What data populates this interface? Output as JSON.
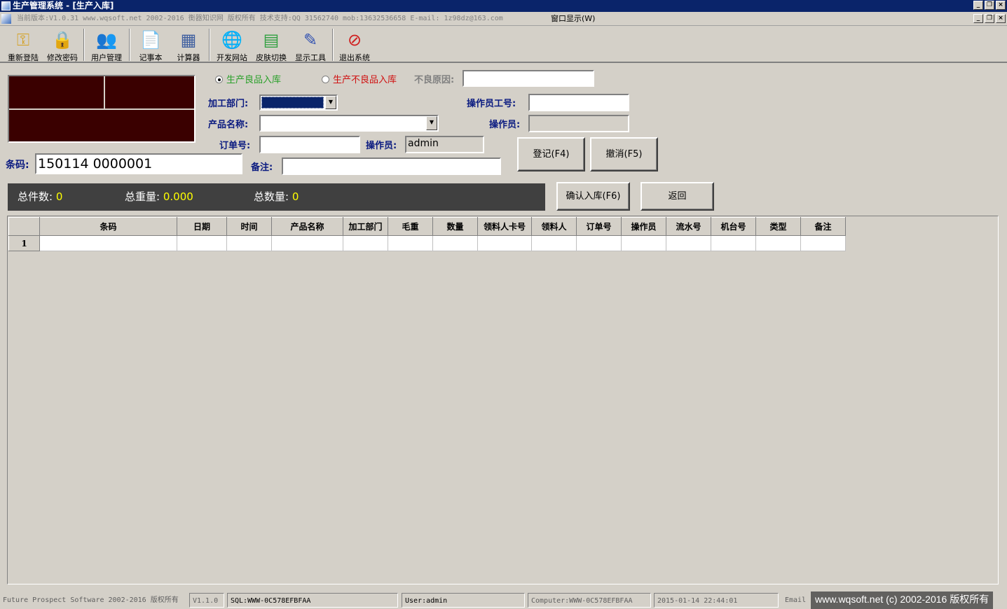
{
  "window": {
    "title": "生产管理系统 - [生产入库]"
  },
  "menubar": {
    "info": "当前版本:V1.0.31   www.wqsoft.net 2002-2016 衡器知识网 版权所有 技术支持:QQ 31562740 mob:13632536658  E-mail: 1z98dz@163.com",
    "window_menu": "窗口显示(W)"
  },
  "toolbar": {
    "items": [
      {
        "label": "重新登陆",
        "icon": "key-icon"
      },
      {
        "label": "修改密码",
        "icon": "lock-icon"
      },
      {
        "label": "用户管理",
        "icon": "users-icon"
      },
      {
        "label": "记事本",
        "icon": "notepad-icon"
      },
      {
        "label": "计算器",
        "icon": "calculator-icon"
      },
      {
        "label": "开发网站",
        "icon": "globe-icon"
      },
      {
        "label": "皮肤切换",
        "icon": "skin-icon"
      },
      {
        "label": "显示工具",
        "icon": "tools-icon"
      },
      {
        "label": "退出系统",
        "icon": "exit-icon"
      }
    ]
  },
  "form": {
    "radio_good": "生产良品入库",
    "radio_bad": "生产不良品入库",
    "bad_reason_label": "不良原因:",
    "bad_reason_value": "",
    "dept_label": "加工部门:",
    "operator_id_label": "操作员工号:",
    "operator_id_value": "",
    "product_label": "产品名称:",
    "operator_label": "操作员:",
    "operator_value": "",
    "order_label": "订单号:",
    "order_value": "",
    "operator2_label": "操作员:",
    "operator2_value": "admin",
    "barcode_label": "条码:",
    "barcode_value": "150114 0000001",
    "remark_label": "备注:",
    "remark_value": "",
    "register_button": "登记(F4)",
    "cancel_button": "撤消(F5)",
    "confirm_button": "确认入库(F6)",
    "back_button": "返回"
  },
  "summary": {
    "count_label": "总件数:",
    "count_value": "0",
    "weight_label": "总重量:",
    "weight_value": "0.000",
    "qty_label": "总数量:",
    "qty_value": "0"
  },
  "grid": {
    "columns": [
      "条码",
      "日期",
      "时间",
      "产品名称",
      "加工部门",
      "毛重",
      "数量",
      "领料人卡号",
      "领料人",
      "订单号",
      "操作员",
      "流水号",
      "机台号",
      "类型",
      "备注"
    ],
    "rows": [
      {
        "index": "1",
        "cells": [
          "",
          "",
          "",
          "",
          "",
          "",
          "",
          "",
          "",
          "",
          "",
          "",
          "",
          "",
          ""
        ]
      }
    ]
  },
  "statusbar": {
    "copyright": "Future Prospect Software 2002-2016 版权所有",
    "version": "V1.1.0",
    "sql": "SQL:WWW-0C578EFBFAA",
    "user": "User:admin",
    "computer": "Computer:WWW-0C578EFBFAA",
    "datetime": "2015-01-14 22:44:01",
    "email": "Email",
    "watermark": "www.wqsoft.net (c) 2002-2016 版权所有"
  },
  "colors": {
    "title_bar": "#0a246a",
    "label_text": "#0a1a80",
    "good_radio": "#2aa02a",
    "bad_radio": "#d01010",
    "summary_value": "#ffff00",
    "led_panel": "#3a0000"
  }
}
